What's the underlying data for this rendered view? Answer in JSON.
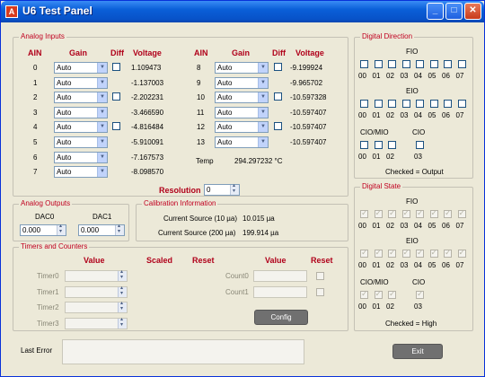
{
  "window": {
    "title": "U6 Test Panel",
    "icon": "labjack-app-icon",
    "min_glyph": "_",
    "max_glyph": "□",
    "close_glyph": "✕"
  },
  "analog_inputs": {
    "title": "Analog Inputs",
    "headers": {
      "ain": "AIN",
      "gain": "Gain",
      "diff": "Diff",
      "voltage": "Voltage"
    },
    "left": [
      {
        "ain": "0",
        "gain": "Auto",
        "voltage": "1.109473"
      },
      {
        "ain": "1",
        "gain": "Auto",
        "voltage": "-1.137003"
      },
      {
        "ain": "2",
        "gain": "Auto",
        "voltage": "-2.202231"
      },
      {
        "ain": "3",
        "gain": "Auto",
        "voltage": "-3.466590"
      },
      {
        "ain": "4",
        "gain": "Auto",
        "voltage": "-4.816484"
      },
      {
        "ain": "5",
        "gain": "Auto",
        "voltage": "-5.910091"
      },
      {
        "ain": "6",
        "gain": "Auto",
        "voltage": "-7.167573"
      },
      {
        "ain": "7",
        "gain": "Auto",
        "voltage": "-8.098570"
      }
    ],
    "right": [
      {
        "ain": "8",
        "gain": "Auto",
        "voltage": "-9.199924"
      },
      {
        "ain": "9",
        "gain": "Auto",
        "voltage": "-9.965702"
      },
      {
        "ain": "10",
        "gain": "Auto",
        "voltage": "-10.597328"
      },
      {
        "ain": "11",
        "gain": "Auto",
        "voltage": "-10.597407"
      },
      {
        "ain": "12",
        "gain": "Auto",
        "voltage": "-10.597407"
      },
      {
        "ain": "13",
        "gain": "Auto",
        "voltage": "-10.597407"
      }
    ],
    "temp_label": "Temp",
    "temp_value": "294.297232 °C",
    "resolution_label": "Resolution",
    "resolution_value": "0"
  },
  "analog_outputs": {
    "title": "Analog Outputs",
    "dac0_label": "DAC0",
    "dac0_value": "0.000",
    "dac1_label": "DAC1",
    "dac1_value": "0.000"
  },
  "calibration": {
    "title": "Calibration Information",
    "src10_label": "Current Source (10 µa)",
    "src10_value": "10.015 µa",
    "src200_label": "Current Source (200 µa)",
    "src200_value": "199.914 µa"
  },
  "timers": {
    "title": "Timers and Counters",
    "headers": {
      "value": "Value",
      "scaled": "Scaled",
      "reset": "Reset",
      "value2": "Value",
      "reset2": "Reset"
    },
    "timers": [
      "Timer0",
      "Timer1",
      "Timer2",
      "Timer3"
    ],
    "counters": [
      "Count0",
      "Count1"
    ],
    "config_button": "Config"
  },
  "last_error": {
    "label": "Last Error",
    "value": ""
  },
  "digital_direction": {
    "title": "Digital Direction",
    "fio": "FIO",
    "eio": "EIO",
    "cio_mio": "CIO/MIO",
    "cio": "CIO",
    "bits": [
      "00",
      "01",
      "02",
      "03",
      "04",
      "05",
      "06",
      "07"
    ],
    "cio_bits": [
      "00",
      "01",
      "02",
      "03"
    ],
    "note": "Checked = Output"
  },
  "digital_state": {
    "title": "Digital State",
    "fio": "FIO",
    "eio": "EIO",
    "cio_mio": "CIO/MIO",
    "cio": "CIO",
    "bits": [
      "00",
      "01",
      "02",
      "03",
      "04",
      "05",
      "06",
      "07"
    ],
    "cio_bits": [
      "00",
      "01",
      "02",
      "03"
    ],
    "note": "Checked = High"
  },
  "exit_button": "Exit"
}
